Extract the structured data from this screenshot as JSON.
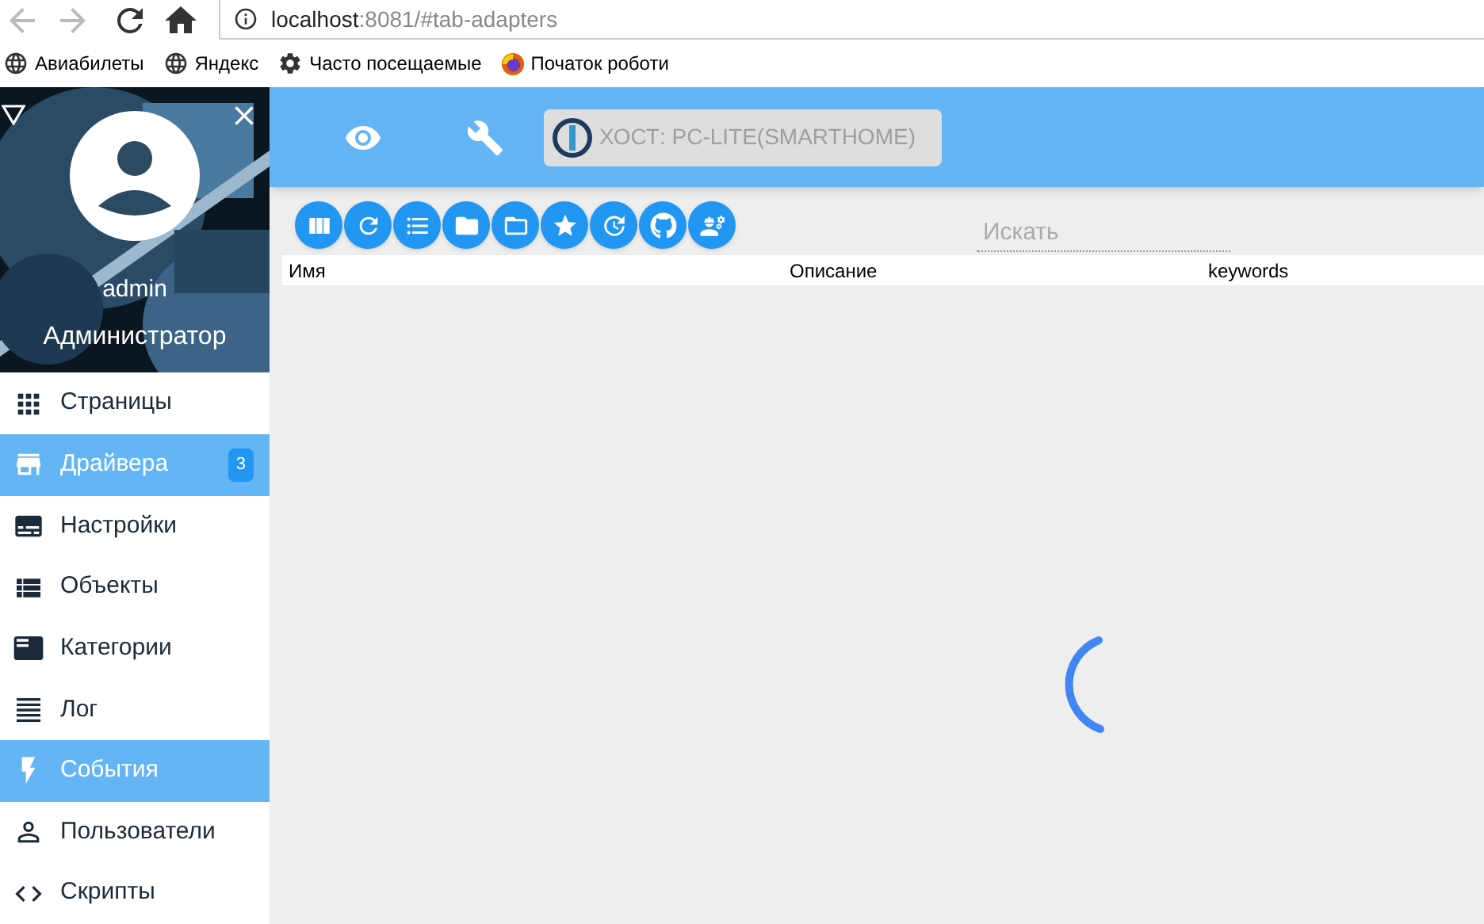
{
  "browser": {
    "url_host": "localhost",
    "url_rest": ":8081/#tab-adapters",
    "bookmarks": [
      {
        "kind": "globe",
        "label": "Авиабилеты"
      },
      {
        "kind": "globe",
        "label": "Яндекс"
      },
      {
        "kind": "gear",
        "label": "Часто посещаемые"
      },
      {
        "kind": "firefox",
        "label": "Початок роботи"
      }
    ]
  },
  "sidebar": {
    "user": "admin",
    "role": "Администратор",
    "items": [
      {
        "label": "Страницы",
        "selected": false
      },
      {
        "label": "Драйвера",
        "selected": true,
        "badge": "3"
      },
      {
        "label": "Настройки",
        "selected": false
      },
      {
        "label": "Объекты",
        "selected": false
      },
      {
        "label": "Категории",
        "selected": false
      },
      {
        "label": "Лог",
        "selected": false
      },
      {
        "label": "События",
        "selected": true
      },
      {
        "label": "Пользователи",
        "selected": false
      },
      {
        "label": "Скрипты",
        "selected": false
      }
    ]
  },
  "header": {
    "host": "ХОСТ: PC-LITE(SMARTHOME)"
  },
  "search": {
    "placeholder": "Искать"
  },
  "table": {
    "columns": [
      "Имя",
      "Описание",
      "keywords"
    ]
  }
}
